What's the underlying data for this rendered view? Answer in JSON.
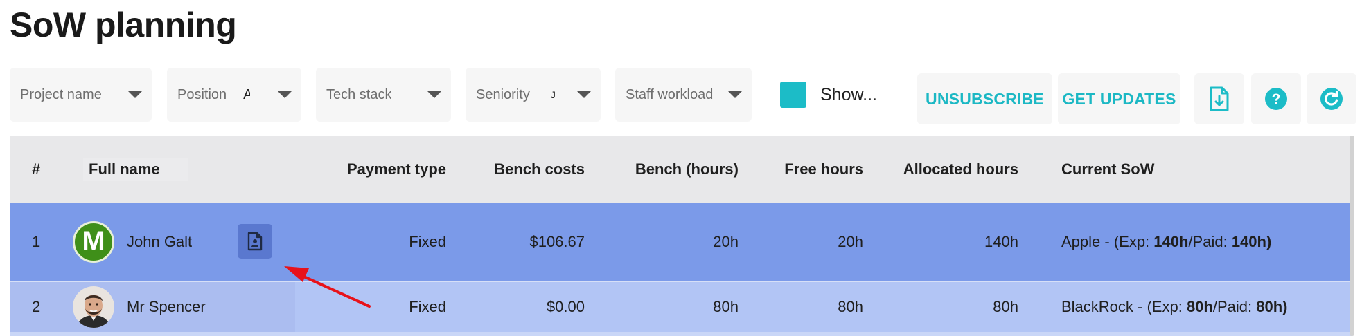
{
  "page_title": "SoW planning",
  "filters": [
    {
      "name": "project-name-filter",
      "label": "Project name",
      "value": ""
    },
    {
      "name": "position-filter",
      "label": "Position",
      "value": "A"
    },
    {
      "name": "tech-stack-filter",
      "label": "Tech stack",
      "value": ""
    },
    {
      "name": "seniority-filter",
      "label": "Seniority",
      "value": "J"
    },
    {
      "name": "staff-workload-filter",
      "label": "Staff workload",
      "value": ""
    }
  ],
  "show_toggle": {
    "label": "Show...",
    "checked": true
  },
  "buttons": {
    "unsubscribe": "UNSUBSCRIBE",
    "get_updates": "GET UPDATES"
  },
  "icons": {
    "export": "file-download-icon",
    "help": "question-circle-icon",
    "refresh": "refresh-icon",
    "row_document": "person-document-icon",
    "annotation": "red-arrow"
  },
  "colors": {
    "accent": "#1cbcc7",
    "row_selected": "#7b9ae9",
    "row_hover": "#b2c5f5",
    "header_bg": "#e8e8ea",
    "avatar_green": "#3f8f19",
    "annotation": "#e8121a"
  },
  "table": {
    "columns": [
      "#",
      "Full name",
      "Payment type",
      "Bench costs",
      "Bench (hours)",
      "Free hours",
      "Allocated hours",
      "Current SoW"
    ],
    "rows": [
      {
        "index": "1",
        "avatar_letter": "M",
        "name": "John Galt",
        "payment_type": "Fixed",
        "bench_costs": "$106.67",
        "bench_hours": "20h",
        "free_hours": "20h",
        "allocated_hours": "140h",
        "sow_client": "Apple - (Exp: ",
        "sow_exp": "140h",
        "sow_paid_label": "/Paid: ",
        "sow_paid": "140h)"
      },
      {
        "index": "2",
        "avatar_letter": "",
        "name": "Mr Spencer",
        "payment_type": "Fixed",
        "bench_costs": "$0.00",
        "bench_hours": "80h",
        "free_hours": "80h",
        "allocated_hours": "80h",
        "sow_client": "BlackRock - (Exp: ",
        "sow_exp": "80h",
        "sow_paid_label": "/Paid: ",
        "sow_paid": "80h)"
      }
    ]
  }
}
